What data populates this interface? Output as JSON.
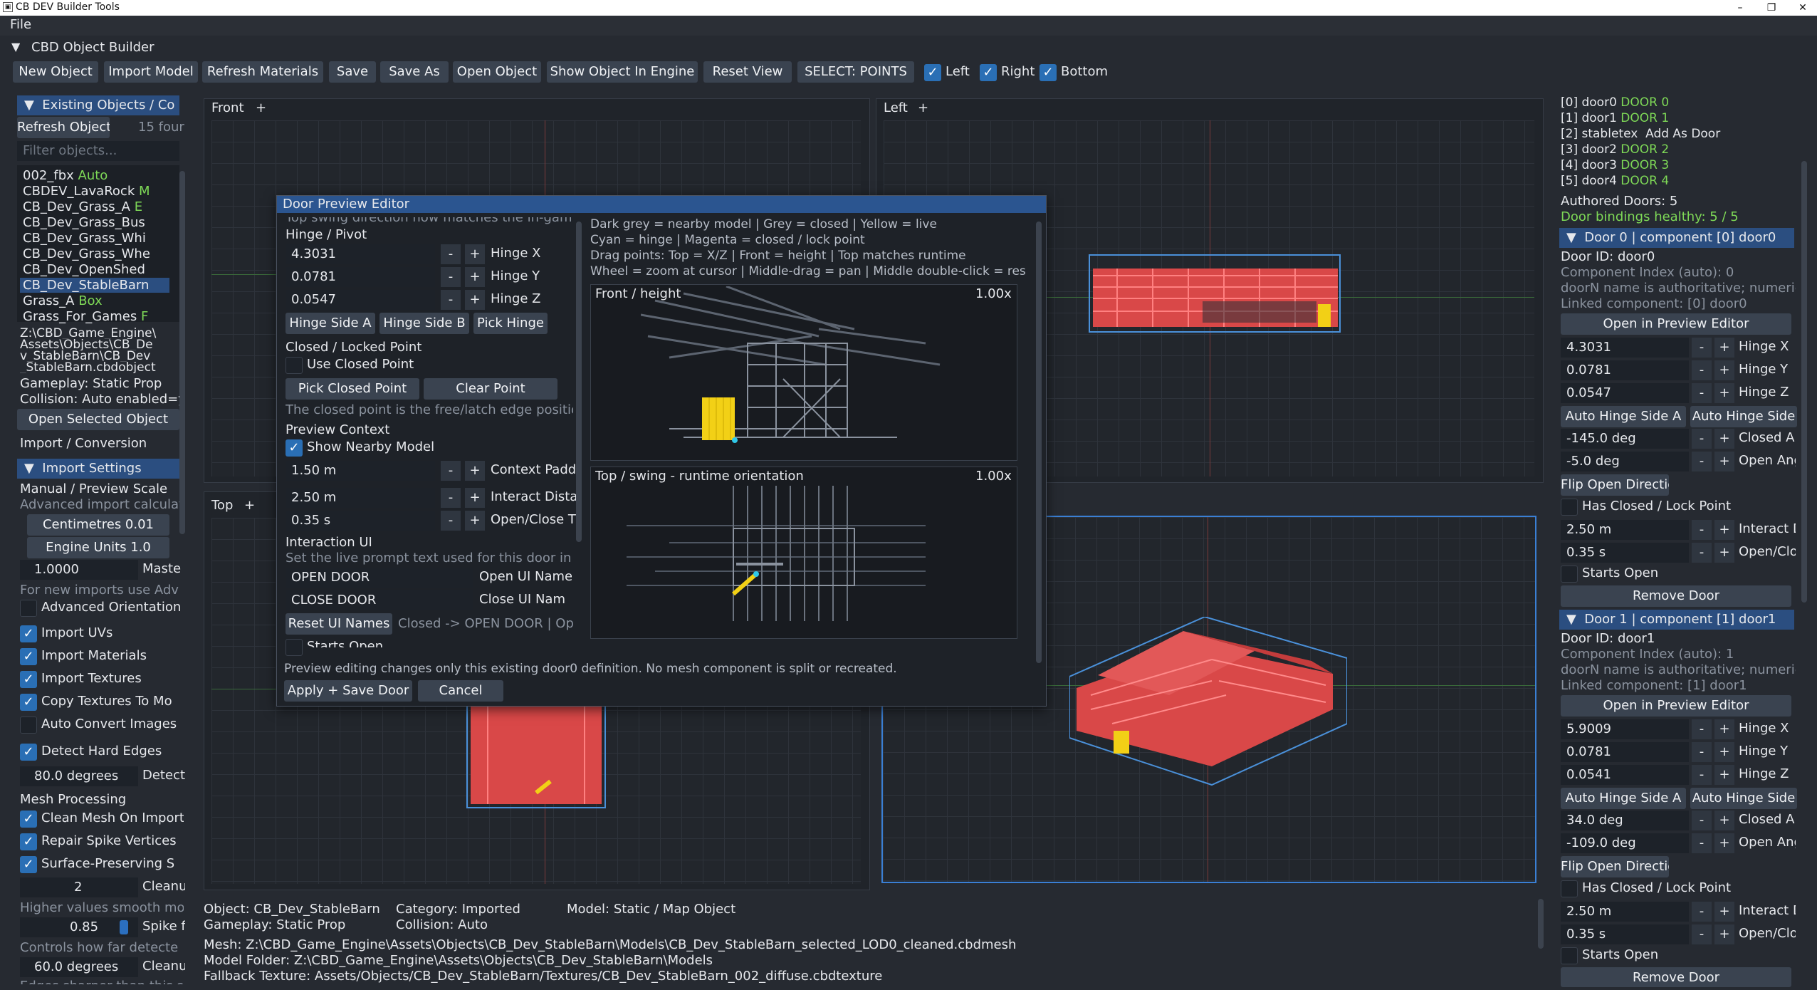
{
  "window": {
    "title": "CB DEV Builder Tools",
    "controls": [
      "–",
      "❐",
      "✕"
    ]
  },
  "menu": {
    "file": "File"
  },
  "builder": {
    "header": "CBD Object Builder"
  },
  "toolbar": {
    "new_object": "New Object",
    "import_model": "Import Model",
    "refresh_materials": "Refresh Materials",
    "save": "Save",
    "save_as": "Save As",
    "open_object": "Open Object",
    "show_in_engine": "Show Object In Engine",
    "reset_view": "Reset View",
    "select_points": "SELECT: POINTS",
    "left": "Left",
    "right": "Right",
    "bottom": "Bottom"
  },
  "left_panel": {
    "existing_header": "Existing Objects / Co",
    "refresh_objects": "Refresh Objects",
    "found": "15 four",
    "filter_placeholder": "Filter objects...",
    "objects": [
      {
        "name": "002_fbx",
        "tag": "Auto"
      },
      {
        "name": "CBDEV_LavaRock",
        "tag": "M"
      },
      {
        "name": "CB_Dev_Grass_A",
        "tag": "E"
      },
      {
        "name": "CB_Dev_Grass_Bus",
        "tag": ""
      },
      {
        "name": "CB_Dev_Grass_Whi",
        "tag": ""
      },
      {
        "name": "CB_Dev_Grass_Whe",
        "tag": ""
      },
      {
        "name": "CB_Dev_OpenShed",
        "tag": ""
      },
      {
        "name": "CB_Dev_StableBarn",
        "tag": ""
      },
      {
        "name": "Grass_A",
        "tag": "Box"
      },
      {
        "name": "Grass_For_Games",
        "tag": "F"
      }
    ],
    "path_lines": [
      "Z:\\CBD_Game_Engine\\",
      "Assets\\Objects\\CB_De",
      "v_StableBarn\\CB_Dev",
      "_StableBarn.cbdobject"
    ],
    "gameplay": "Gameplay: Static Prop",
    "collision": "Collision: Auto  enabled=y",
    "open_selected": "Open Selected Object",
    "import_conversion": "Import / Conversion",
    "import_settings": "Import Settings",
    "manual_scale": "Manual / Preview Scale",
    "advanced_calc": "Advanced import calculat",
    "centimetres": "Centimetres 0.01",
    "engine_units": "Engine Units 1.0",
    "scale_value": "1.0000",
    "scale_label": "Maste",
    "adv_note": "For new imports use Adv",
    "advanced_orientation": "Advanced Orientation",
    "import_uvs": "Import UVs",
    "import_materials": "Import Materials",
    "import_textures": "Import Textures",
    "copy_textures": "Copy Textures To Mo",
    "auto_convert": "Auto Convert Images",
    "detect_hard_edges": "Detect Hard Edges",
    "degrees_value": "80.0 degrees",
    "degrees_label": "Detect",
    "mesh_processing": "Mesh Processing",
    "clean_mesh": "Clean Mesh On Import",
    "repair_spike": "Repair Spike Vertices",
    "surface_preserving": "Surface-Preserving S",
    "clean_value": "2",
    "clean_label": "Cleanu",
    "higher_values": "Higher values smooth mo",
    "spike_value": "0.85",
    "spike_label": "Spike f",
    "controls_note": "Controls how far detecte",
    "cleanup_degrees": "60.0 degrees",
    "cleanup_label": "Cleanu",
    "edges_note": "Edges sharper than this s"
  },
  "viewports": {
    "front": "Front",
    "left": "Left",
    "top": "Top",
    "plus": "+"
  },
  "dialog": {
    "title": "Door Preview Editor",
    "cut_text": "Top swing direction now matches the in-gam",
    "hinge_pivot": "Hinge / Pivot",
    "hinge_x": "4.3031",
    "hinge_x_label": "Hinge X",
    "hinge_y": "0.0781",
    "hinge_y_label": "Hinge Y",
    "hinge_z": "0.0547",
    "hinge_z_label": "Hinge Z",
    "hinge_side_a": "Hinge Side A",
    "hinge_side_b": "Hinge Side B",
    "pick_hinge": "Pick Hinge",
    "closed_locked": "Closed / Locked Point",
    "use_closed": "Use Closed Point",
    "pick_closed": "Pick Closed Point",
    "clear_point": "Clear Point",
    "closed_note": "The closed point is the free/latch edge positio",
    "preview_context": "Preview Context",
    "show_nearby": "Show Nearby Model",
    "context_pad": "1.50 m",
    "context_pad_label": "Context Padd",
    "interact_dist": "2.50 m",
    "interact_dist_label": "Interact Dista",
    "open_close": "0.35 s",
    "open_close_label": "Open/Close T",
    "interaction_ui": "Interaction UI",
    "prompt_note": "Set the live prompt text used for this door in g",
    "open_door": "OPEN DOOR",
    "open_ui_name": "Open UI Name",
    "close_door": "CLOSE DOOR",
    "close_ui_name": "Close UI Nam",
    "reset_ui": "Reset UI Names",
    "ui_summary": "Closed -> OPEN DOOR  |  Op",
    "starts_open": "Starts Open",
    "legend1": "Dark grey = nearby model | Grey = closed | Yellow = live",
    "legend2": "Cyan = hinge | Magenta = closed / lock point",
    "legend3": "Drag points: Top = X/Z | Front = height | Top matches runtime",
    "legend4": "Wheel = zoom at cursor | Middle-drag = pan | Middle double-click = res",
    "front_height": "Front / height",
    "front_zoom": "1.00x",
    "top_swing": "Top / swing - runtime orientation",
    "top_zoom": "1.00x",
    "footer_note": "Preview editing changes only this existing door0 definition. No mesh component is split or recreated.",
    "apply_save": "Apply + Save Door",
    "cancel": "Cancel"
  },
  "right_panel": {
    "components": [
      {
        "idx": "[0] door0",
        "tag": "DOOR 0"
      },
      {
        "idx": "[1] door1",
        "tag": "DOOR 1"
      },
      {
        "idx": "[2] stabletex",
        "tag": "Add As Door"
      },
      {
        "idx": "[3] door2",
        "tag": "DOOR 2"
      },
      {
        "idx": "[4] door3",
        "tag": "DOOR 3"
      },
      {
        "idx": "[5] door4",
        "tag": "DOOR 4"
      }
    ],
    "authored": "Authored Doors: 5",
    "healthy": "Door bindings healthy: 5 / 5",
    "doors": [
      {
        "header": "Door 0 | component [0] door0",
        "id": "Door ID: door0",
        "comp_index": "Component Index (auto): 0",
        "authoritative": "doorN name is authoritative; numeric i",
        "linked": "Linked component: [0] door0",
        "open_preview": "Open in Preview Editor",
        "hinge_x": "4.3031",
        "hinge_y": "0.0781",
        "hinge_z": "0.0547",
        "hx_label": "Hinge X",
        "hy_label": "Hinge Y",
        "hz_label": "Hinge Z",
        "auto_a": "Auto Hinge Side A",
        "auto_b": "Auto Hinge Side",
        "closed_angle": "-145.0 deg",
        "closed_label": "Closed Ang",
        "open_angle": "-5.0 deg",
        "open_label": "Open Angle",
        "flip": "Flip Open Direction",
        "has_closed": "Has Closed / Lock Point",
        "interact": "2.50 m",
        "interact_label": "Interact Dis",
        "openclose": "0.35 s",
        "openclose_label": "Open/Clos",
        "starts_open": "Starts Open",
        "remove": "Remove Door"
      },
      {
        "header": "Door 1 | component [1] door1",
        "id": "Door ID: door1",
        "comp_index": "Component Index (auto): 1",
        "authoritative": "doorN name is authoritative; numeric i",
        "linked": "Linked component: [1] door1",
        "open_preview": "Open in Preview Editor",
        "hinge_x": "5.9009",
        "hinge_y": "0.0781",
        "hinge_z": "0.0541",
        "hx_label": "Hinge X",
        "hy_label": "Hinge Y",
        "hz_label": "Hinge Z",
        "auto_a": "Auto Hinge Side A",
        "auto_b": "Auto Hinge Side",
        "closed_angle": "34.0 deg",
        "closed_label": "Closed Ang",
        "open_angle": "-109.0 deg",
        "open_label": "Open Angle",
        "flip": "Flip Open Direction",
        "has_closed": "Has Closed / Lock Point",
        "interact": "2.50 m",
        "interact_label": "Interact Dis",
        "openclose": "0.35 s",
        "openclose_label": "Open/Clos",
        "starts_open": "Starts Open",
        "remove": "Remove Door"
      }
    ]
  },
  "status": {
    "object": "Object: CB_Dev_StableBarn",
    "category": "Category: Imported",
    "model": "Model: Static / Map Object",
    "gameplay": "Gameplay: Static Prop",
    "collision": "Collision: Auto",
    "mesh": "Mesh: Z:\\CBD_Game_Engine\\Assets\\Objects\\CB_Dev_StableBarn\\Models\\CB_Dev_StableBarn_selected_LOD0_cleaned.cbdmesh",
    "model_folder": "Model Folder: Z:\\CBD_Game_Engine\\Assets\\Objects\\CB_Dev_StableBarn\\Models",
    "fallback": "Fallback Texture: Assets/Objects/CB_Dev_StableBarn/Textures/CB_Dev_StableBarn_002_diffuse.cbdtexture"
  },
  "colors": {
    "accent": "#2b6fbf",
    "header": "#2b4e80",
    "mesh": "#e05050",
    "door": "#f2d016",
    "hinge": "#30c8e8",
    "healthy": "#7ed957"
  }
}
